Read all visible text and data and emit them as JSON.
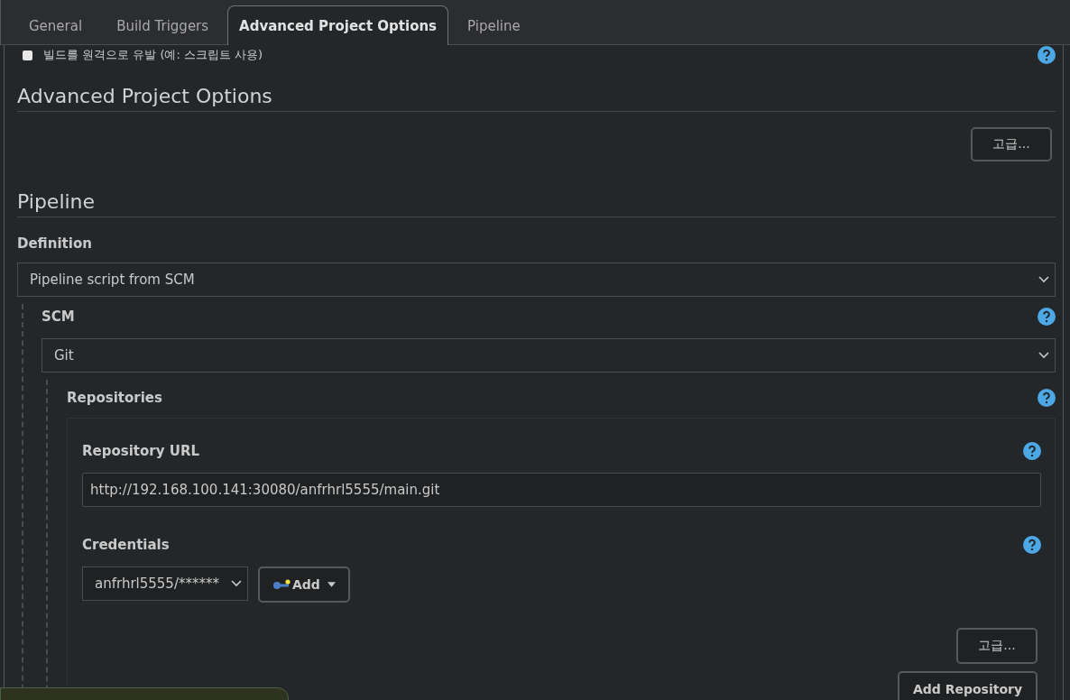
{
  "tabs": [
    {
      "label": "General",
      "selected": false
    },
    {
      "label": "Build Triggers",
      "selected": false
    },
    {
      "label": "Advanced Project Options",
      "selected": true
    },
    {
      "label": "Pipeline",
      "selected": false
    }
  ],
  "trigger_option": {
    "label": "빌드를 원격으로 유발 (예: 스크립트 사용)",
    "checked": false
  },
  "advanced_section": {
    "title": "Advanced Project Options",
    "button": "고급..."
  },
  "pipeline": {
    "title": "Pipeline",
    "definition_label": "Definition",
    "definition_value": "Pipeline script from SCM",
    "scm_label": "SCM",
    "scm_value": "Git",
    "repositories_label": "Repositories",
    "repository_url_label": "Repository URL",
    "repository_url": "http://192.168.100.141:30080/anfrhrl5555/main.git",
    "credentials_label": "Credentials",
    "credentials_value": "anfrhrl5555/******",
    "add_button": "Add",
    "advanced_button": "고급...",
    "add_repository_button": "Add Repository"
  }
}
